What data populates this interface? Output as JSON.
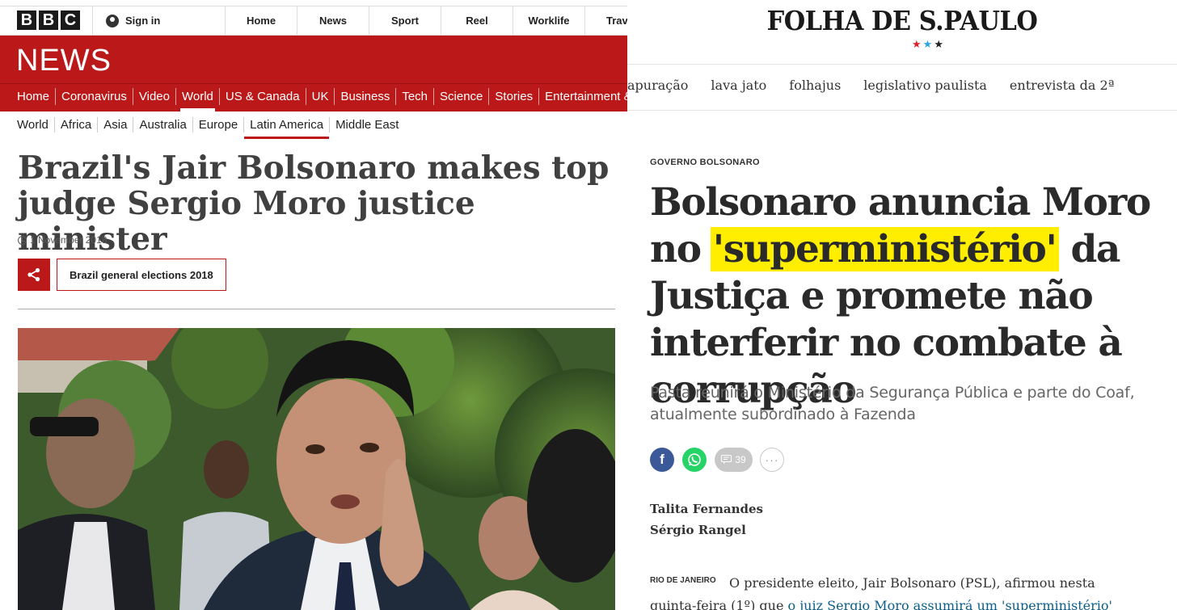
{
  "bbc": {
    "logo_letters": [
      "B",
      "B",
      "C"
    ],
    "signin": "Sign in",
    "top_nav": [
      "Home",
      "News",
      "Sport",
      "Reel",
      "Worklife",
      "Trav"
    ],
    "news_word": "NEWS",
    "main_nav": [
      "Home",
      "Coronavirus",
      "Video",
      "World",
      "US & Canada",
      "UK",
      "Business",
      "Tech",
      "Science",
      "Stories",
      "Entertainment &"
    ],
    "main_nav_active": "World",
    "sub_nav": [
      "World",
      "Africa",
      "Asia",
      "Australia",
      "Europe",
      "Latin America",
      "Middle East"
    ],
    "sub_nav_active": "Latin America",
    "headline": "Brazil's Jair Bolsonaro makes top judge Sergio Moro justice minister",
    "date": "1 November 2018",
    "topic_tag": "Brazil general elections 2018",
    "colors": {
      "brand_red": "#bb1919"
    }
  },
  "folha": {
    "logo": "FOLHA DE S.PAULO",
    "stars": [
      "★",
      "★",
      "★"
    ],
    "star_colors": [
      "#e0202b",
      "#2aa7df",
      "#222222"
    ],
    "nav": [
      "apuração",
      "lava jato",
      "folhajus",
      "legislativo paulista",
      "entrevista da 2ª"
    ],
    "kicker": "GOVERNO BOLSONARO",
    "headline_before": "Bolsonaro anuncia Moro no",
    "headline_highlight": "'superministério'",
    "headline_after": "da Justiça e promete não interferir no combate à corrupção",
    "subtitle": "Pasta reunirá o Ministério da Segurança Pública e parte do Coaf, atualmente subordinado à Fazenda",
    "comment_count": "39",
    "authors": [
      "Talita Fernandes",
      "Sérgio Rangel"
    ],
    "place": "RIO DE JANEIRO",
    "body_line1": "O presidente eleito, Jair Bolsonaro (PSL), afirmou nesta",
    "body_line2_text": "quinta-feira (1º) que ",
    "body_line2_link": "o juiz Sergio Moro assumirá um 'superministério'",
    "colors": {
      "highlight": "#ffee00",
      "facebook": "#3b5998",
      "whatsapp": "#25d366",
      "link": "#0a5e8a"
    }
  }
}
